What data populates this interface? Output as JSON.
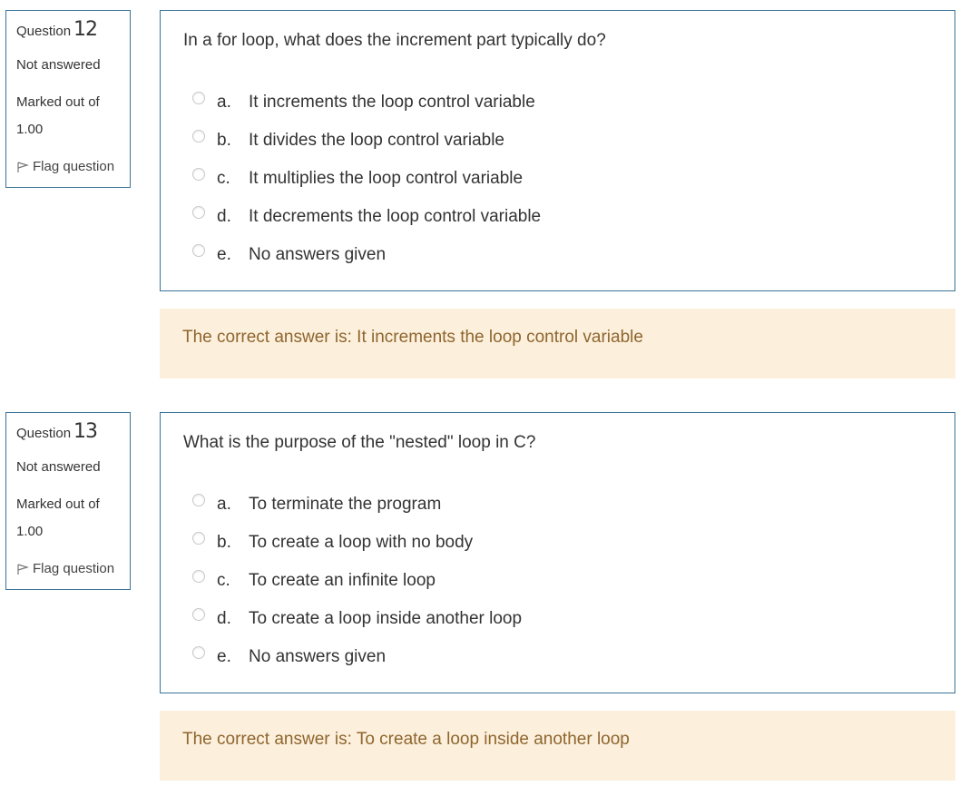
{
  "questions": [
    {
      "label": "Question",
      "number": "12",
      "state": "Not answered",
      "marked_label": "Marked out of",
      "marked_value": "1.00",
      "flag_label": "Flag question",
      "text": "In a for loop, what does the increment part typically do?",
      "options": [
        {
          "letter": "a.",
          "text": "It increments the loop control variable"
        },
        {
          "letter": "b.",
          "text": "It divides the loop control variable"
        },
        {
          "letter": "c.",
          "text": "It multiplies the loop control variable"
        },
        {
          "letter": "d.",
          "text": "It decrements the loop control variable"
        },
        {
          "letter": "e.",
          "text": "No answers given"
        }
      ],
      "feedback": "The correct answer is: It increments the loop control variable"
    },
    {
      "label": "Question",
      "number": "13",
      "state": "Not answered",
      "marked_label": "Marked out of",
      "marked_value": "1.00",
      "flag_label": "Flag question",
      "text": "What is the purpose of the \"nested\" loop in C?",
      "options": [
        {
          "letter": "a.",
          "text": "To terminate the program"
        },
        {
          "letter": "b.",
          "text": "To create a loop with no body"
        },
        {
          "letter": "c.",
          "text": "To create an infinite loop"
        },
        {
          "letter": "d.",
          "text": "To create a loop inside another loop"
        },
        {
          "letter": "e.",
          "text": "No answers given"
        }
      ],
      "feedback": "The correct answer is: To create a loop inside another loop"
    }
  ],
  "colors": {
    "border": "#3a7497",
    "feedback_bg": "#fcefdc",
    "feedback_text": "#8e662e",
    "text": "#333333"
  },
  "icons": {
    "flag": "flag-icon",
    "radio": "radio-unchecked-icon"
  }
}
